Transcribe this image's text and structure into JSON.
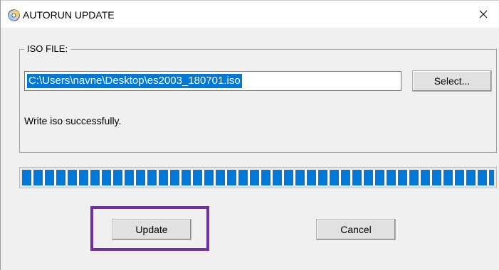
{
  "window": {
    "title": "AUTORUN UPDATE",
    "app_icon": "cd-disc-icon",
    "close_icon": "close-icon"
  },
  "iso_group": {
    "legend": "ISO FILE:",
    "path_value": "C:\\Users\\navne\\Desktop\\es2003_180701.iso",
    "select_label": "Select..."
  },
  "status": {
    "text": "Write iso successfully."
  },
  "progress": {
    "percent": 100,
    "color": "#0078d7"
  },
  "buttons": {
    "update_label": "Update",
    "cancel_label": "Cancel"
  },
  "annotation": {
    "highlight_color": "#7030a0"
  }
}
